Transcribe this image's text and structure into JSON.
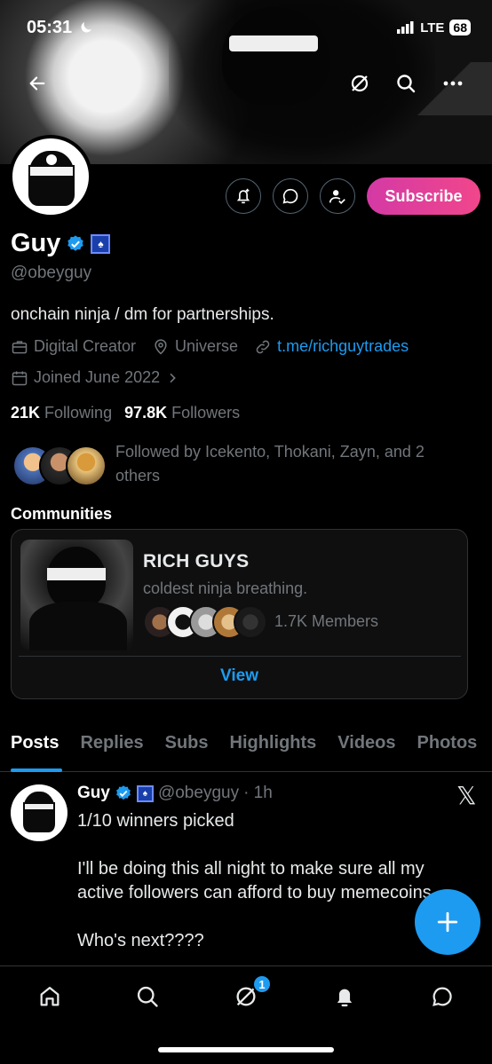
{
  "status_bar": {
    "time": "05:31",
    "network": "LTE",
    "battery": "68"
  },
  "header": {
    "back_icon": "back-arrow-icon",
    "grok_icon": "grok-icon",
    "search_icon": "search-icon",
    "more_icon": "more-icon"
  },
  "profile": {
    "name": "Guy",
    "handle": "@obeyguy",
    "bio": "onchain ninja / dm for partnerships.",
    "category": "Digital Creator",
    "location": "Universe",
    "link": "t.me/richguytrades",
    "joined": "Joined June 2022",
    "following_count": "21K",
    "following_label": "Following",
    "followers_count": "97.8K",
    "followers_label": "Followers",
    "followed_by": "Followed by Icekento, Thokani, Zayn, and 2 others",
    "subscribe_label": "Subscribe"
  },
  "communities": {
    "title": "Communities",
    "card": {
      "name": "RICH GUYS",
      "description": "coldest ninja breathing.",
      "members": "1.7K Members",
      "view_label": "View"
    }
  },
  "tabs": [
    "Posts",
    "Replies",
    "Subs",
    "Highlights",
    "Videos",
    "Photos"
  ],
  "active_tab": "Posts",
  "post": {
    "author": "Guy",
    "handle": "@obeyguy",
    "time": "· 1h",
    "line1": "1/10 winners picked",
    "line2": "I'll be doing this all night to make sure all my active followers can afford to buy memecoins",
    "line3": "Who's next????"
  },
  "nav": {
    "notifications_badge": "1"
  },
  "colors": {
    "accent": "#1d9bf0",
    "subscribe_start": "#d43aa5",
    "subscribe_end": "#f0468b",
    "muted": "#71767b"
  }
}
